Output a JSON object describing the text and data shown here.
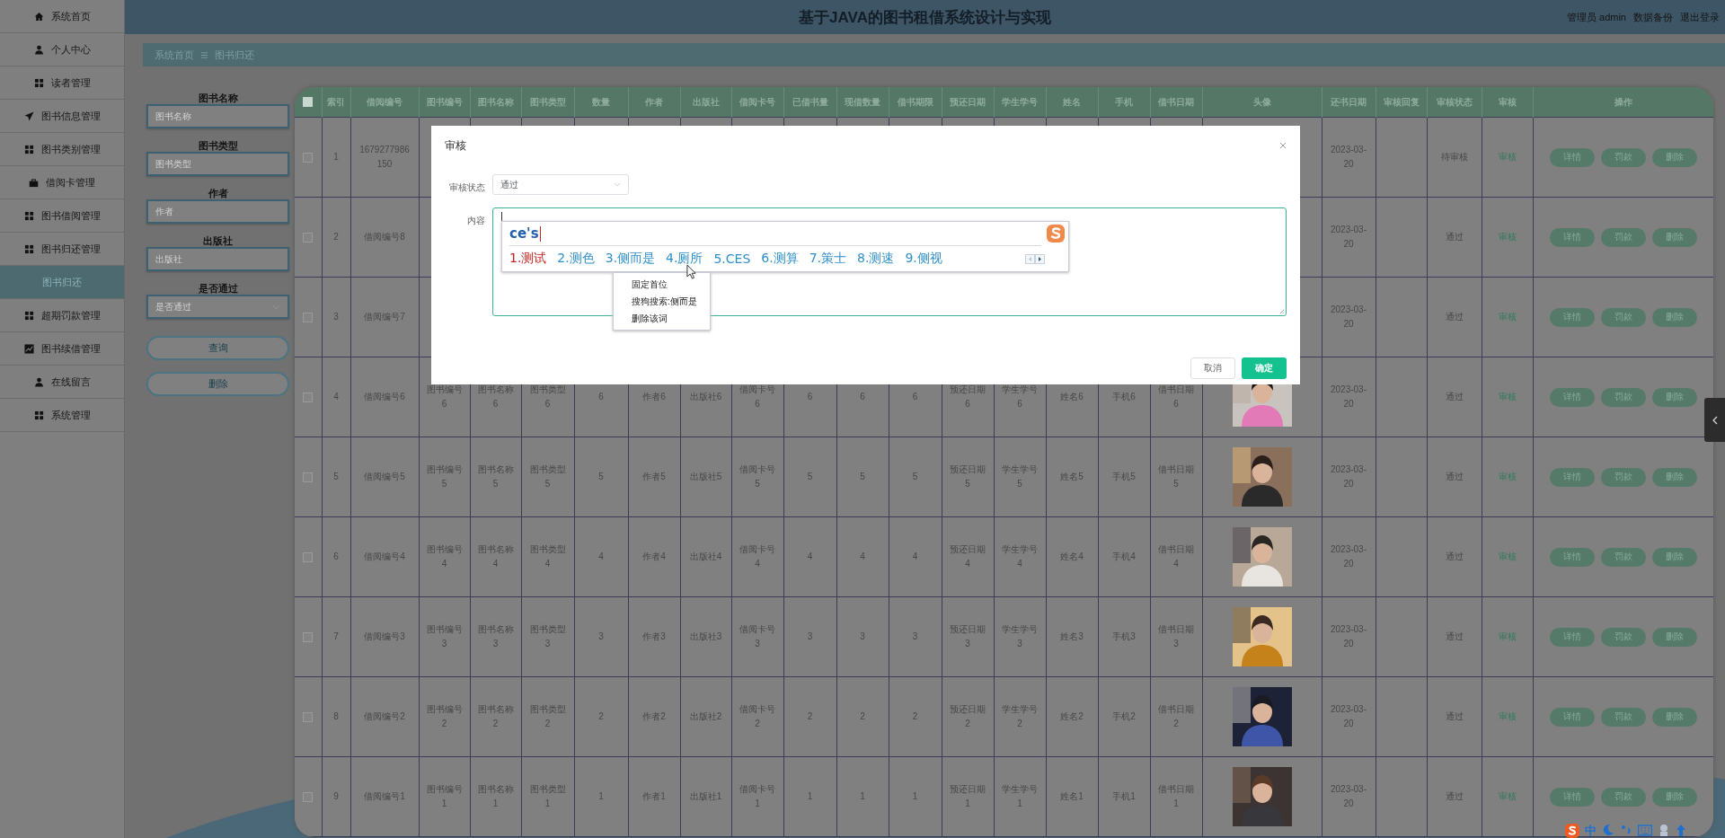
{
  "sidebar": {
    "items": [
      {
        "label": "系统首页",
        "selected": false
      },
      {
        "label": "个人中心",
        "selected": false
      },
      {
        "label": "读者管理",
        "selected": false
      },
      {
        "label": "图书信息管理",
        "selected": false
      },
      {
        "label": "图书类别管理",
        "selected": false
      },
      {
        "label": "借阅卡管理",
        "selected": false
      },
      {
        "label": "图书借阅管理",
        "selected": false
      },
      {
        "label": "图书归还管理",
        "selected": false,
        "children": [
          {
            "label": "图书归还",
            "selected": true
          }
        ]
      },
      {
        "label": "超期罚款管理",
        "selected": false
      },
      {
        "label": "图书续借管理",
        "selected": false
      },
      {
        "label": "在线留言",
        "selected": false
      },
      {
        "label": "系统管理",
        "selected": false
      }
    ]
  },
  "header": {
    "title": "基于JAVA的图书租借系统设计与实现",
    "user": "管理员 admin",
    "links": [
      "数据备份",
      "退出登录"
    ]
  },
  "breadcrumb": [
    "系统首页",
    "图书归还"
  ],
  "search": {
    "fields": [
      {
        "label": "图书名称",
        "placeholder": "图书名称",
        "kind": "input"
      },
      {
        "label": "图书类型",
        "placeholder": "图书类型",
        "kind": "input"
      },
      {
        "label": "作者",
        "placeholder": "作者",
        "kind": "input"
      },
      {
        "label": "出版社",
        "placeholder": "出版社",
        "kind": "input"
      },
      {
        "label": "是否通过",
        "placeholder": "是否通过",
        "kind": "select"
      }
    ],
    "buttons": [
      "查询",
      "删除"
    ]
  },
  "table": {
    "select_all": {
      "checked": false
    },
    "columns": [
      "索引",
      "借阅编号",
      "图书编号",
      "图书名称",
      "图书类型",
      "数量",
      "作者",
      "出版社",
      "借阅卡号",
      "已借书量",
      "现借数量",
      "借书期限",
      "预还日期",
      "学生学号",
      "姓名",
      "手机",
      "借书日期",
      "头像",
      "还书日期",
      "审核回复",
      "审核状态",
      "审核",
      "操作"
    ],
    "rows": [
      {
        "checked": false,
        "index": "1",
        "borrow_no": "1679277986150",
        "return_date": "2023-03-20",
        "status": "待审核",
        "review": "审核",
        "actions": [
          "详情",
          "罚款",
          "删除"
        ]
      },
      {
        "checked": false,
        "index": "2",
        "borrow_no": "借阅编号8",
        "return_date": "2023-03-20",
        "status": "通过",
        "review": "审核",
        "actions": [
          "详情",
          "罚款",
          "删除"
        ]
      },
      {
        "checked": false,
        "index": "3",
        "borrow_no": "借阅编号7",
        "return_date": "2023-03-20",
        "status": "通过",
        "review": "审核",
        "actions": [
          "详情",
          "罚款",
          "删除"
        ]
      },
      {
        "checked": false,
        "index": "4",
        "borrow_no": "借阅编号6",
        "book_no": "图书编号6",
        "book_name": "图书名称6",
        "book_type": "图书类型6",
        "quantity": "6",
        "author": "作者6",
        "publisher": "出版社6",
        "card_no": "借阅卡号6",
        "borrowed": "6",
        "current": "6",
        "term": "6",
        "due_date": "预还日期6",
        "student_no": "学生学号6",
        "name": "姓名6",
        "phone": "手机6",
        "borrow_date": "借书日期6",
        "return_date": "2023-03-20",
        "status": "通过",
        "review": "审核",
        "actions": [
          "详情",
          "罚款",
          "删除"
        ]
      },
      {
        "checked": false,
        "index": "5",
        "borrow_no": "借阅编号5",
        "book_no": "图书编号5",
        "book_name": "图书名称5",
        "book_type": "图书类型5",
        "quantity": "5",
        "author": "作者5",
        "publisher": "出版社5",
        "card_no": "借阅卡号5",
        "borrowed": "5",
        "current": "5",
        "term": "5",
        "due_date": "预还日期5",
        "student_no": "学生学号5",
        "name": "姓名5",
        "phone": "手机5",
        "borrow_date": "借书日期5",
        "return_date": "2023-03-20",
        "status": "通过",
        "review": "审核",
        "actions": [
          "详情",
          "罚款",
          "删除"
        ]
      },
      {
        "checked": false,
        "index": "6",
        "borrow_no": "借阅编号4",
        "book_no": "图书编号4",
        "book_name": "图书名称4",
        "book_type": "图书类型4",
        "quantity": "4",
        "author": "作者4",
        "publisher": "出版社4",
        "card_no": "借阅卡号4",
        "borrowed": "4",
        "current": "4",
        "term": "4",
        "due_date": "预还日期4",
        "student_no": "学生学号4",
        "name": "姓名4",
        "phone": "手机4",
        "borrow_date": "借书日期4",
        "return_date": "2023-03-20",
        "status": "通过",
        "review": "审核",
        "actions": [
          "详情",
          "罚款",
          "删除"
        ]
      },
      {
        "checked": false,
        "index": "7",
        "borrow_no": "借阅编号3",
        "book_no": "图书编号3",
        "book_name": "图书名称3",
        "book_type": "图书类型3",
        "quantity": "3",
        "author": "作者3",
        "publisher": "出版社3",
        "card_no": "借阅卡号3",
        "borrowed": "3",
        "current": "3",
        "term": "3",
        "due_date": "预还日期3",
        "student_no": "学生学号3",
        "name": "姓名3",
        "phone": "手机3",
        "borrow_date": "借书日期3",
        "return_date": "2023-03-20",
        "status": "通过",
        "review": "审核",
        "actions": [
          "详情",
          "罚款",
          "删除"
        ]
      },
      {
        "checked": false,
        "index": "8",
        "borrow_no": "借阅编号2",
        "book_no": "图书编号2",
        "book_name": "图书名称2",
        "book_type": "图书类型2",
        "quantity": "2",
        "author": "作者2",
        "publisher": "出版社2",
        "card_no": "借阅卡号2",
        "borrowed": "2",
        "current": "2",
        "term": "2",
        "due_date": "预还日期2",
        "student_no": "学生学号2",
        "name": "姓名2",
        "phone": "手机2",
        "borrow_date": "借书日期2",
        "return_date": "2023-03-20",
        "status": "通过",
        "review": "审核",
        "actions": [
          "详情",
          "罚款",
          "删除"
        ]
      },
      {
        "checked": false,
        "index": "9",
        "borrow_no": "借阅编号1",
        "book_no": "图书编号1",
        "book_name": "图书名称1",
        "book_type": "图书类型1",
        "quantity": "1",
        "author": "作者1",
        "publisher": "出版社1",
        "card_no": "借阅卡号1",
        "borrowed": "1",
        "current": "1",
        "term": "1",
        "due_date": "预还日期1",
        "student_no": "学生学号1",
        "name": "姓名1",
        "phone": "手机1",
        "borrow_date": "借书日期1",
        "return_date": "2023-03-20",
        "status": "通过",
        "review": "审核",
        "actions": [
          "详情",
          "罚款",
          "删除"
        ]
      }
    ]
  },
  "dialog": {
    "title": "审核",
    "fields": [
      {
        "label": "审核状态",
        "kind": "select",
        "value": "通过"
      },
      {
        "label": "内容",
        "kind": "textarea"
      }
    ],
    "buttons": [
      {
        "label": "取消",
        "kind": "plain"
      },
      {
        "label": "确定",
        "kind": "primary"
      }
    ]
  },
  "ime": {
    "composition": "ce's",
    "candidates": [
      {
        "text": "1.测试",
        "selected": true
      },
      {
        "text": "2.测色",
        "selected": false
      },
      {
        "text": "3.侧而是",
        "selected": false
      },
      {
        "text": "4.厕所",
        "selected": false
      },
      {
        "text": "5.CES",
        "selected": false
      },
      {
        "text": "6.测算",
        "selected": false
      },
      {
        "text": "7.策士",
        "selected": false
      },
      {
        "text": "8.测速",
        "selected": false
      },
      {
        "text": "9.侧视",
        "selected": false
      }
    ]
  },
  "context_menu": {
    "items": [
      "固定首位",
      "搜狗搜索:侧而是",
      "删除该词"
    ]
  },
  "ime_toolbar": {
    "mode": "中"
  }
}
